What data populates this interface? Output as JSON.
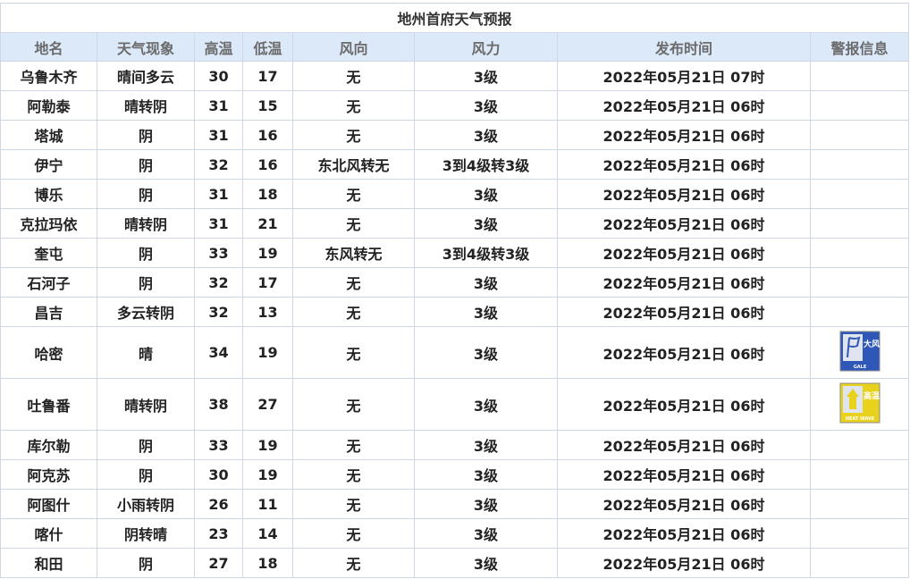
{
  "table": {
    "title": "地州首府天气预报",
    "headers": [
      "地名",
      "天气现象",
      "高温",
      "低温",
      "风向",
      "风力",
      "发布时间",
      "警报信息"
    ],
    "rows": [
      {
        "city": "乌鲁木齐",
        "weather": "晴间多云",
        "high": "30",
        "low": "17",
        "wind_dir": "无",
        "wind_force": "3级",
        "time": "2022年05月21日 07时",
        "alert": null
      },
      {
        "city": "阿勒泰",
        "weather": "晴转阴",
        "high": "31",
        "low": "15",
        "wind_dir": "无",
        "wind_force": "3级",
        "time": "2022年05月21日 06时",
        "alert": null
      },
      {
        "city": "塔城",
        "weather": "阴",
        "high": "31",
        "low": "16",
        "wind_dir": "无",
        "wind_force": "3级",
        "time": "2022年05月21日 06时",
        "alert": null
      },
      {
        "city": "伊宁",
        "weather": "阴",
        "high": "32",
        "low": "16",
        "wind_dir": "东北风转无",
        "wind_force": "3到4级转3级",
        "time": "2022年05月21日 06时",
        "alert": null
      },
      {
        "city": "博乐",
        "weather": "阴",
        "high": "31",
        "low": "18",
        "wind_dir": "无",
        "wind_force": "3级",
        "time": "2022年05月21日 06时",
        "alert": null
      },
      {
        "city": "克拉玛依",
        "weather": "晴转阴",
        "high": "31",
        "low": "21",
        "wind_dir": "无",
        "wind_force": "3级",
        "time": "2022年05月21日 06时",
        "alert": null
      },
      {
        "city": "奎屯",
        "weather": "阴",
        "high": "33",
        "low": "19",
        "wind_dir": "东风转无",
        "wind_force": "3到4级转3级",
        "time": "2022年05月21日 06时",
        "alert": null
      },
      {
        "city": "石河子",
        "weather": "阴",
        "high": "32",
        "low": "17",
        "wind_dir": "无",
        "wind_force": "3级",
        "time": "2022年05月21日 06时",
        "alert": null
      },
      {
        "city": "昌吉",
        "weather": "多云转阴",
        "high": "32",
        "low": "13",
        "wind_dir": "无",
        "wind_force": "3级",
        "time": "2022年05月21日 06时",
        "alert": null
      },
      {
        "city": "哈密",
        "weather": "晴",
        "high": "34",
        "low": "19",
        "wind_dir": "无",
        "wind_force": "3级",
        "time": "2022年05月21日 06时",
        "alert": {
          "icon": "gale-warning-blue-icon",
          "color": "#2f57b8",
          "label_cn": "大风",
          "label_en": "GALE"
        }
      },
      {
        "city": "吐鲁番",
        "weather": "晴转阴",
        "high": "38",
        "low": "27",
        "wind_dir": "无",
        "wind_force": "3级",
        "time": "2022年05月21日 06时",
        "alert": {
          "icon": "heat-warning-yellow-icon",
          "color": "#e8d21e",
          "label_cn": "高温",
          "label_en": "HEAT WAVE"
        }
      },
      {
        "city": "库尔勒",
        "weather": "阴",
        "high": "33",
        "low": "19",
        "wind_dir": "无",
        "wind_force": "3级",
        "time": "2022年05月21日 06时",
        "alert": null
      },
      {
        "city": "阿克苏",
        "weather": "阴",
        "high": "30",
        "low": "19",
        "wind_dir": "无",
        "wind_force": "3级",
        "time": "2022年05月21日 06时",
        "alert": null
      },
      {
        "city": "阿图什",
        "weather": "小雨转阴",
        "high": "26",
        "low": "11",
        "wind_dir": "无",
        "wind_force": "3级",
        "time": "2022年05月21日 06时",
        "alert": null
      },
      {
        "city": "喀什",
        "weather": "阴转晴",
        "high": "23",
        "low": "14",
        "wind_dir": "无",
        "wind_force": "3级",
        "time": "2022年05月21日 06时",
        "alert": null
      },
      {
        "city": "和田",
        "weather": "阴",
        "high": "27",
        "low": "18",
        "wind_dir": "无",
        "wind_force": "3级",
        "time": "2022年05月21日 06时",
        "alert": null
      }
    ]
  }
}
